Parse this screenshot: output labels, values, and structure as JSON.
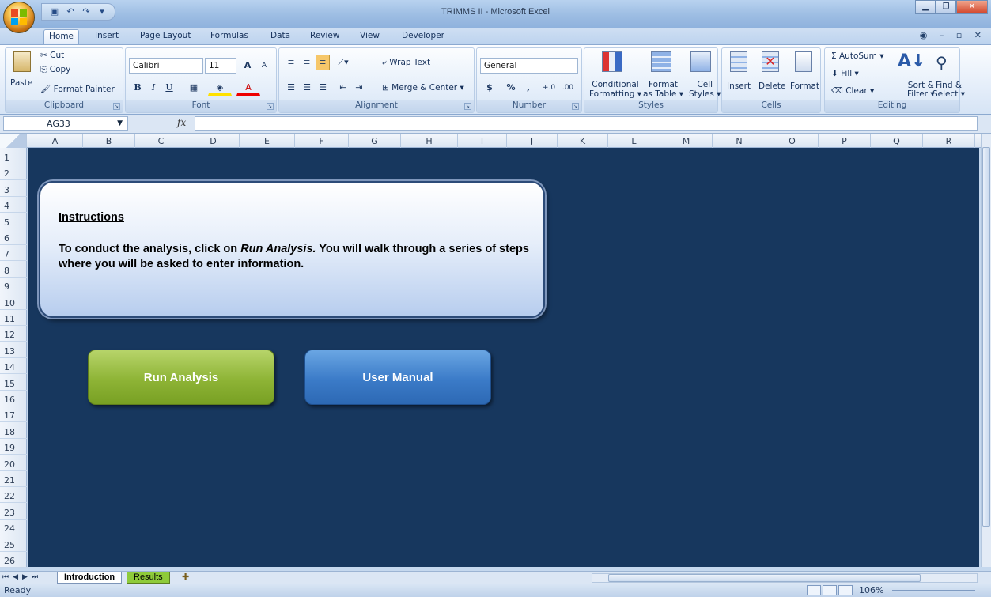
{
  "window": {
    "title": "TRIMMS II - Microsoft Excel"
  },
  "ribbon_tabs": [
    "Home",
    "Insert",
    "Page Layout",
    "Formulas",
    "Data",
    "Review",
    "View",
    "Developer"
  ],
  "clipboard": {
    "paste": "Paste",
    "cut": "Cut",
    "copy": "Copy",
    "format_painter": "Format Painter",
    "label": "Clipboard"
  },
  "font": {
    "name": "Calibri",
    "size": "11",
    "label": "Font"
  },
  "alignment": {
    "wrap": "Wrap Text",
    "merge": "Merge & Center",
    "label": "Alignment"
  },
  "number": {
    "format": "General",
    "label": "Number",
    "dollar": "$",
    "percent": "%",
    "comma": ","
  },
  "styles": {
    "cond1": "Conditional",
    "cond2": "Formatting",
    "fmt1": "Format",
    "fmt2": "as Table",
    "cell1": "Cell",
    "cell2": "Styles",
    "label": "Styles"
  },
  "cells": {
    "insert": "Insert",
    "delete": "Delete",
    "format": "Format",
    "label": "Cells"
  },
  "editing": {
    "autosum": "AutoSum",
    "fill": "Fill",
    "clear": "Clear",
    "sort1": "Sort &",
    "sort2": "Filter",
    "find1": "Find &",
    "find2": "Select",
    "label": "Editing"
  },
  "formula_bar": {
    "name_box": "AG33",
    "fx": "fx",
    "value": ""
  },
  "columns": [
    "A",
    "B",
    "C",
    "D",
    "E",
    "F",
    "G",
    "H",
    "I",
    "J",
    "K",
    "L",
    "M",
    "N",
    "O",
    "P",
    "Q",
    "R"
  ],
  "rows": [
    "1",
    "2",
    "3",
    "4",
    "5",
    "6",
    "7",
    "8",
    "9",
    "10",
    "11",
    "12",
    "13",
    "14",
    "15",
    "16",
    "17",
    "18",
    "19",
    "20",
    "21",
    "22",
    "23",
    "24",
    "25",
    "26"
  ],
  "instructions": {
    "heading": "Instructions",
    "text_before": "To conduct the analysis, click on ",
    "text_italic": "Run Analysis.",
    "text_after": " You will walk through a series of steps where you will be asked to enter information."
  },
  "buttons": {
    "run": "Run Analysis",
    "manual": "User Manual"
  },
  "sheets": {
    "active": "Introduction",
    "other": "Results"
  },
  "status": {
    "ready": "Ready",
    "zoom": "106%"
  },
  "colors": {
    "sheet_bg": "#17375e",
    "run_btn": "#8eb436",
    "manual_btn": "#3b7bc8"
  }
}
